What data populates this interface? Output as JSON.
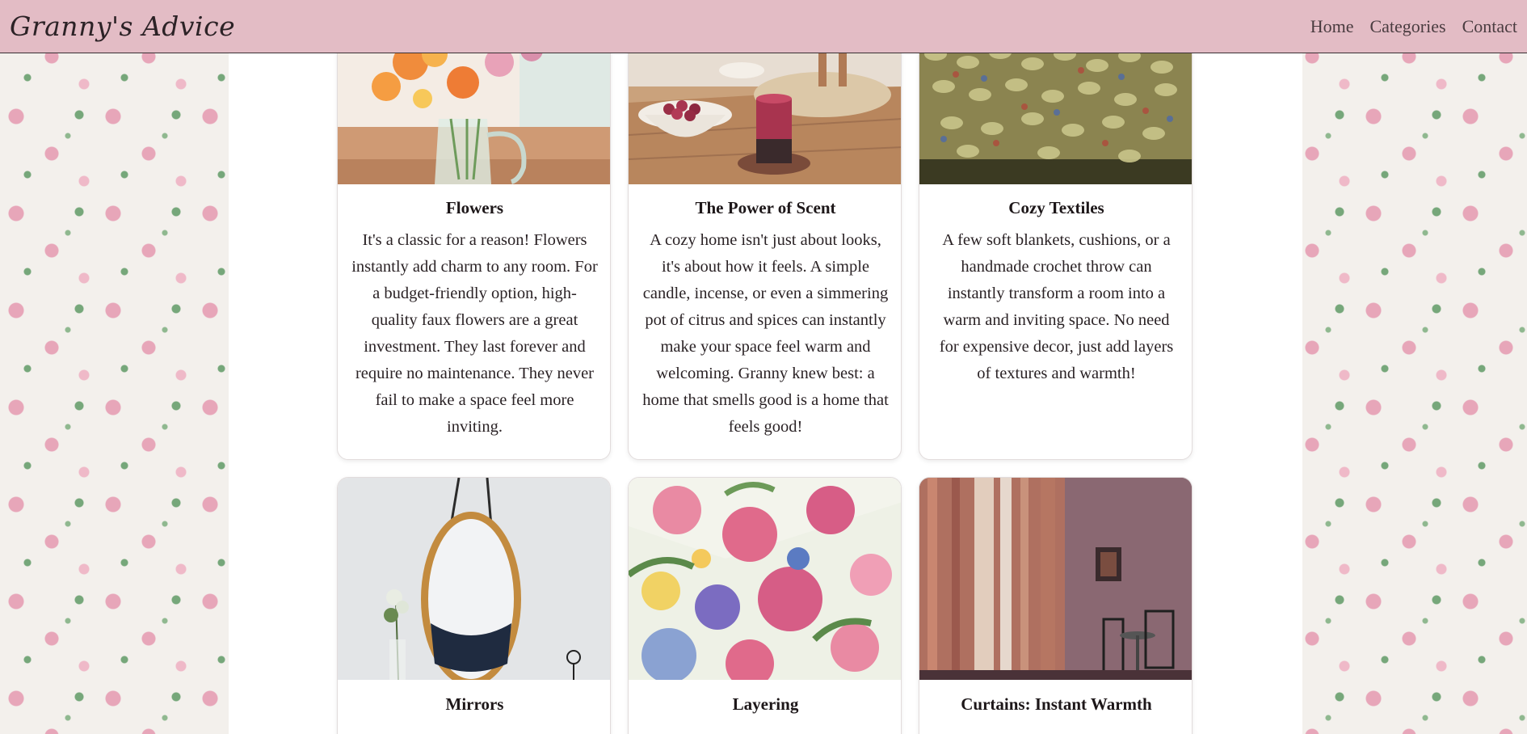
{
  "header": {
    "brand": "Granny's Advice",
    "nav": [
      {
        "label": "Home"
      },
      {
        "label": "Categories"
      },
      {
        "label": "Contact"
      }
    ]
  },
  "cards": [
    {
      "title": "Flowers",
      "text": "It's a classic for a reason! Flowers instantly add charm to any room. For a budget-friendly option, high-quality faux flowers are a great investment. They last forever and require no maintenance. They never fail to make a space feel more inviting.",
      "image": "flowers-in-vase-photo"
    },
    {
      "title": "The Power of Scent",
      "text": "A cozy home isn't just about looks, it's about how it feels. A simple candle, incense, or even a simmering pot of citrus and spices can instantly make your space feel warm and welcoming. Granny knew best: a home that smells good is a home that feels good!",
      "image": "candle-on-table-photo"
    },
    {
      "title": "Cozy Textiles",
      "text": "A few soft blankets, cushions, or a handmade crochet throw can instantly transform a room into a warm and inviting space. No need for expensive decor, just add layers of textures and warmth!",
      "image": "knitted-blanket-photo"
    },
    {
      "title": "Mirrors",
      "text": "",
      "image": "oval-mirror-photo"
    },
    {
      "title": "Layering",
      "text": "",
      "image": "floral-fabric-photo"
    },
    {
      "title": "Curtains: Instant Warmth",
      "text": "",
      "image": "sheer-curtains-photo"
    }
  ],
  "colors": {
    "header_bg": "#e3bcc5",
    "page_bg": "#f3f0ec",
    "card_bg": "#ffffff",
    "text": "#2a2225"
  }
}
